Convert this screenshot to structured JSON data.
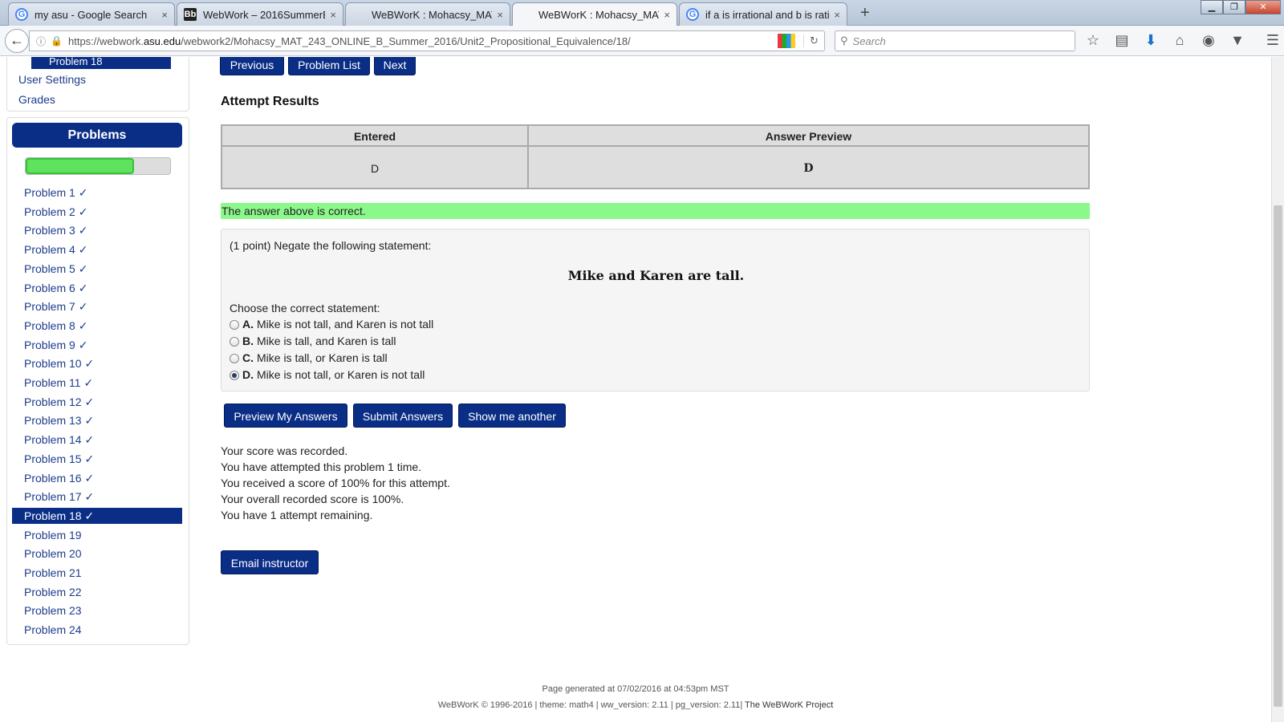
{
  "browser": {
    "tabs": [
      {
        "title": "my asu - Google Search",
        "favicon": "google-icon",
        "favicon_text": "G"
      },
      {
        "title": "WebWork – 2016SummerB...",
        "favicon": "blackboard-icon",
        "favicon_text": "Bb"
      },
      {
        "title": "WeBWorK : Mohacsy_MAT...",
        "favicon": "none",
        "favicon_text": ""
      },
      {
        "title": "WeBWorK : Mohacsy_MAT...",
        "favicon": "none",
        "favicon_text": "",
        "active": true
      },
      {
        "title": "if a is irrational and b is rati...",
        "favicon": "google-icon",
        "favicon_text": "G"
      }
    ],
    "close_glyph": "×",
    "new_tab_glyph": "+",
    "url_prefix": "https://webwork.",
    "url_domain": "asu.edu",
    "url_path": "/webwork2/Mohacsy_MAT_243_ONLINE_B_Summer_2016/Unit2_Propositional_Equivalence/18/",
    "search_placeholder": "Search",
    "window_controls": [
      "▁",
      "❐",
      "✕"
    ]
  },
  "sidebar": {
    "current_problem_tab": "Problem 18",
    "links": [
      "User Settings",
      "Grades"
    ],
    "problems_heading": "Problems",
    "progress_fraction": 0.75,
    "problems": [
      "Problem 1 ✓",
      "Problem 2 ✓",
      "Problem 3 ✓",
      "Problem 4 ✓",
      "Problem 5 ✓",
      "Problem 6 ✓",
      "Problem 7 ✓",
      "Problem 8 ✓",
      "Problem 9 ✓",
      "Problem 10 ✓",
      "Problem 11 ✓",
      "Problem 12 ✓",
      "Problem 13 ✓",
      "Problem 14 ✓",
      "Problem 15 ✓",
      "Problem 16 ✓",
      "Problem 17 ✓",
      "Problem 18 ✓",
      "Problem 19",
      "Problem 20",
      "Problem 21",
      "Problem 22",
      "Problem 23",
      "Problem 24"
    ],
    "current_index": 17
  },
  "main": {
    "nav": {
      "previous": "Previous",
      "problem_list": "Problem List",
      "next": "Next"
    },
    "attempt_heading": "Attempt Results",
    "results": {
      "col_entered": "Entered",
      "col_preview": "Answer Preview",
      "entered": "D",
      "preview": "D"
    },
    "correct_message": "The answer above is correct.",
    "problem": {
      "intro": "(1 point) Negate the following statement:",
      "statement": "Mike and Karen are tall.",
      "choose_label": "Choose the correct statement:",
      "choices": [
        {
          "letter": "A.",
          "text": "Mike is not tall, and Karen is not tall",
          "selected": false
        },
        {
          "letter": "B.",
          "text": "Mike is tall, and Karen is tall",
          "selected": false
        },
        {
          "letter": "C.",
          "text": "Mike is tall, or Karen is tall",
          "selected": false
        },
        {
          "letter": "D.",
          "text": "Mike is not tall, or Karen is not tall",
          "selected": true
        }
      ]
    },
    "buttons": {
      "preview": "Preview My Answers",
      "submit": "Submit Answers",
      "another": "Show me another"
    },
    "score_messages": [
      "Your score was recorded.",
      "You have attempted this problem 1 time.",
      "You received a score of 100% for this attempt.",
      "Your overall recorded score is 100%.",
      "You have 1 attempt remaining."
    ],
    "email_button": "Email instructor"
  },
  "footer": {
    "generated": "Page generated at 07/02/2016 at 04:53pm MST",
    "copyright": "WeBWorK © 1996-2016 | theme: math4 | ww_version: 2.11 | pg_version: 2.11|",
    "project": "The WeBWorK Project"
  },
  "colors": {
    "accent": "#0a2d86",
    "correct": "#8bf88b",
    "progress": "#5fe35f"
  }
}
